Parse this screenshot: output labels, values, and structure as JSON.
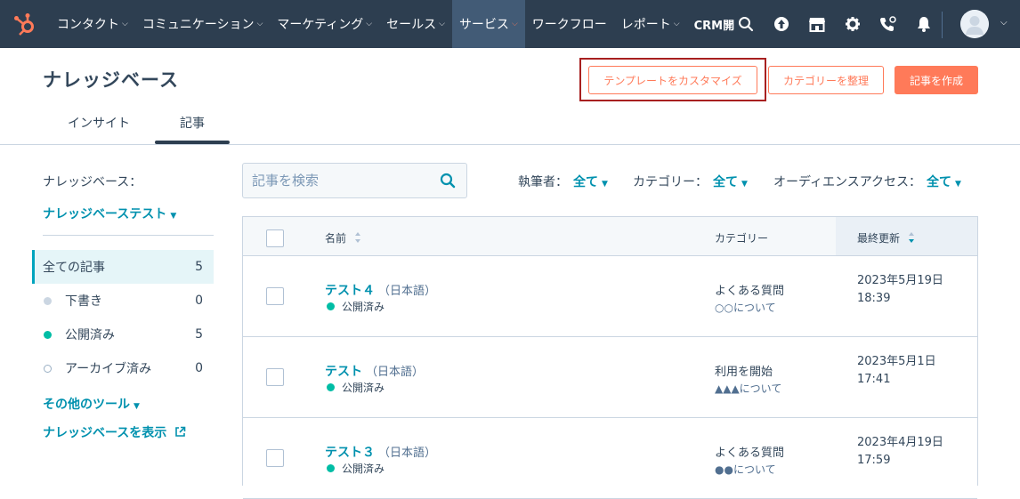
{
  "nav": {
    "items": [
      {
        "label": "コンタクト"
      },
      {
        "label": "コミュニケーション"
      },
      {
        "label": "マーケティング"
      },
      {
        "label": "セールス"
      },
      {
        "label": "サービス"
      },
      {
        "label": "ワークフロー"
      },
      {
        "label": "レポート"
      },
      {
        "label": "CRM開"
      }
    ],
    "icons": [
      "search-icon",
      "upgrade-icon",
      "marketplace-icon",
      "settings-icon",
      "calling-icon",
      "notifications-icon"
    ],
    "active_color": "#ff7a59"
  },
  "header": {
    "title": "ナレッジベース",
    "customize_template": "テンプレートをカスタマイズ",
    "organize_categories": "カテゴリーを整理",
    "create_article": "記事を作成"
  },
  "tabs": [
    {
      "label": "インサイト"
    },
    {
      "label": "記事"
    }
  ],
  "filters": {
    "kb_label": "ナレッジベース：",
    "search_placeholder": "記事を検索",
    "author_label": "執筆者：",
    "author_value": "全て",
    "category_label": "カテゴリー：",
    "category_value": "全て",
    "audience_label": "オーディエンスアクセス：",
    "audience_value": "全て"
  },
  "sidebar": {
    "kb_name": "ナレッジベーステスト",
    "items": [
      {
        "label": "全ての記事",
        "count": "5"
      },
      {
        "label": "下書き",
        "count": "0"
      },
      {
        "label": "公開済み",
        "count": "5"
      },
      {
        "label": "アーカイブ済み",
        "count": "0"
      }
    ],
    "other_tools": "その他のツール",
    "view_kb": "ナレッジベースを表示"
  },
  "table": {
    "columns": {
      "name": "名前",
      "category": "カテゴリー",
      "updated": "最終更新"
    },
    "rows": [
      {
        "title": "テスト４",
        "lang": "（日本語）",
        "status": "公開済み",
        "category": "よくある質問",
        "subcategory": "○○について",
        "date": "2023年5月19日",
        "time": "18:39"
      },
      {
        "title": "テスト",
        "lang": "（日本語）",
        "status": "公開済み",
        "category": "利用を開始",
        "subcategory": "▲▲▲について",
        "date": "2023年5月1日",
        "time": "17:41"
      },
      {
        "title": "テスト３",
        "lang": "（日本語）",
        "status": "公開済み",
        "category": "よくある質問",
        "subcategory": "●●について",
        "date": "2023年4月19日",
        "time": "17:59"
      }
    ]
  }
}
